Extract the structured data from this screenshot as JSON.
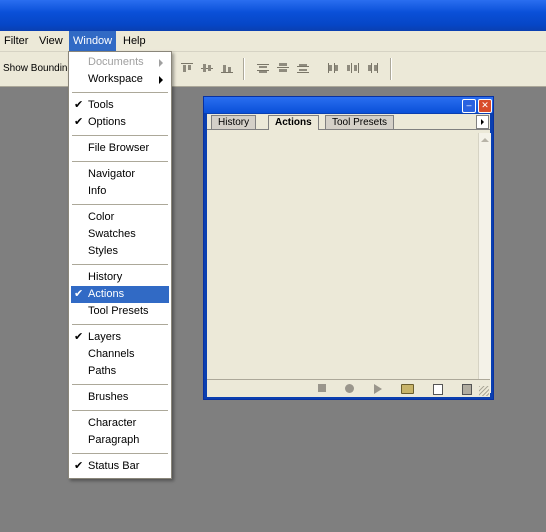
{
  "menubar": {
    "items": [
      {
        "label": "Filter"
      },
      {
        "label": "View"
      },
      {
        "label": "Window"
      },
      {
        "label": "Help"
      }
    ]
  },
  "options_bar": {
    "show_bounding_label": "Show Bounding"
  },
  "window_menu": {
    "documents": "Documents",
    "workspace": "Workspace",
    "tools": "Tools",
    "options": "Options",
    "file_browser": "File Browser",
    "navigator": "Navigator",
    "info": "Info",
    "color": "Color",
    "swatches": "Swatches",
    "styles": "Styles",
    "history": "History",
    "actions": "Actions",
    "tool_presets": "Tool Presets",
    "layers": "Layers",
    "channels": "Channels",
    "paths": "Paths",
    "brushes": "Brushes",
    "character": "Character",
    "paragraph": "Paragraph",
    "status_bar": "Status Bar",
    "check_mark": "✔"
  },
  "palette": {
    "tabs": {
      "history": "History",
      "actions": "Actions",
      "tool_presets": "Tool Presets"
    },
    "close_glyph": "✕",
    "minimize_glyph": "–"
  },
  "colors": {
    "title_blue": "#0a50d8",
    "selection_blue": "#316ac5",
    "workspace_gray": "#7f7f7f",
    "panel_beige": "#ece9d8"
  }
}
